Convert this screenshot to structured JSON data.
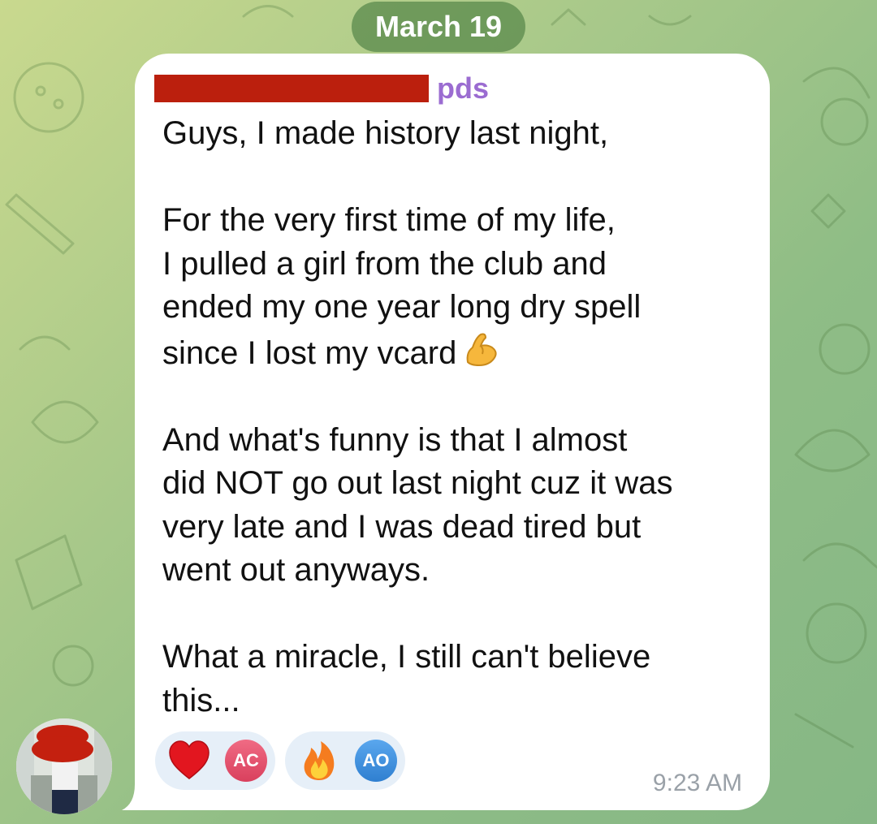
{
  "chat": {
    "date_label": "March 19"
  },
  "message": {
    "sender_suffix": "pds",
    "paragraphs": [
      "Guys, I made history last night,",
      "For the very first time of my life,\nI pulled a girl from the club and\nended my one year long dry spell\nsince I lost my vcard",
      "And what's funny is that I almost\ndid NOT go out last night cuz it was\nvery late and I was dead tired but\nwent out anyways.",
      "What a miracle, I still can't believe\nthis..."
    ],
    "inline_emoji": "flexed-biceps",
    "time": "9:23 AM",
    "reactions": [
      {
        "emoji": "red-heart",
        "user_initials": "AC",
        "avatar_color": "#e8546f"
      },
      {
        "emoji": "fire",
        "user_initials": "AO",
        "avatar_color": "#3f8fdc"
      }
    ]
  },
  "colors": {
    "background_top": "#c9d98e",
    "background_bottom": "#86b785",
    "sender_name": "#9b6cd1",
    "redaction": "#bb1f0d",
    "reaction_chip": "#e6eff8",
    "timestamp": "#9aa1a8"
  }
}
